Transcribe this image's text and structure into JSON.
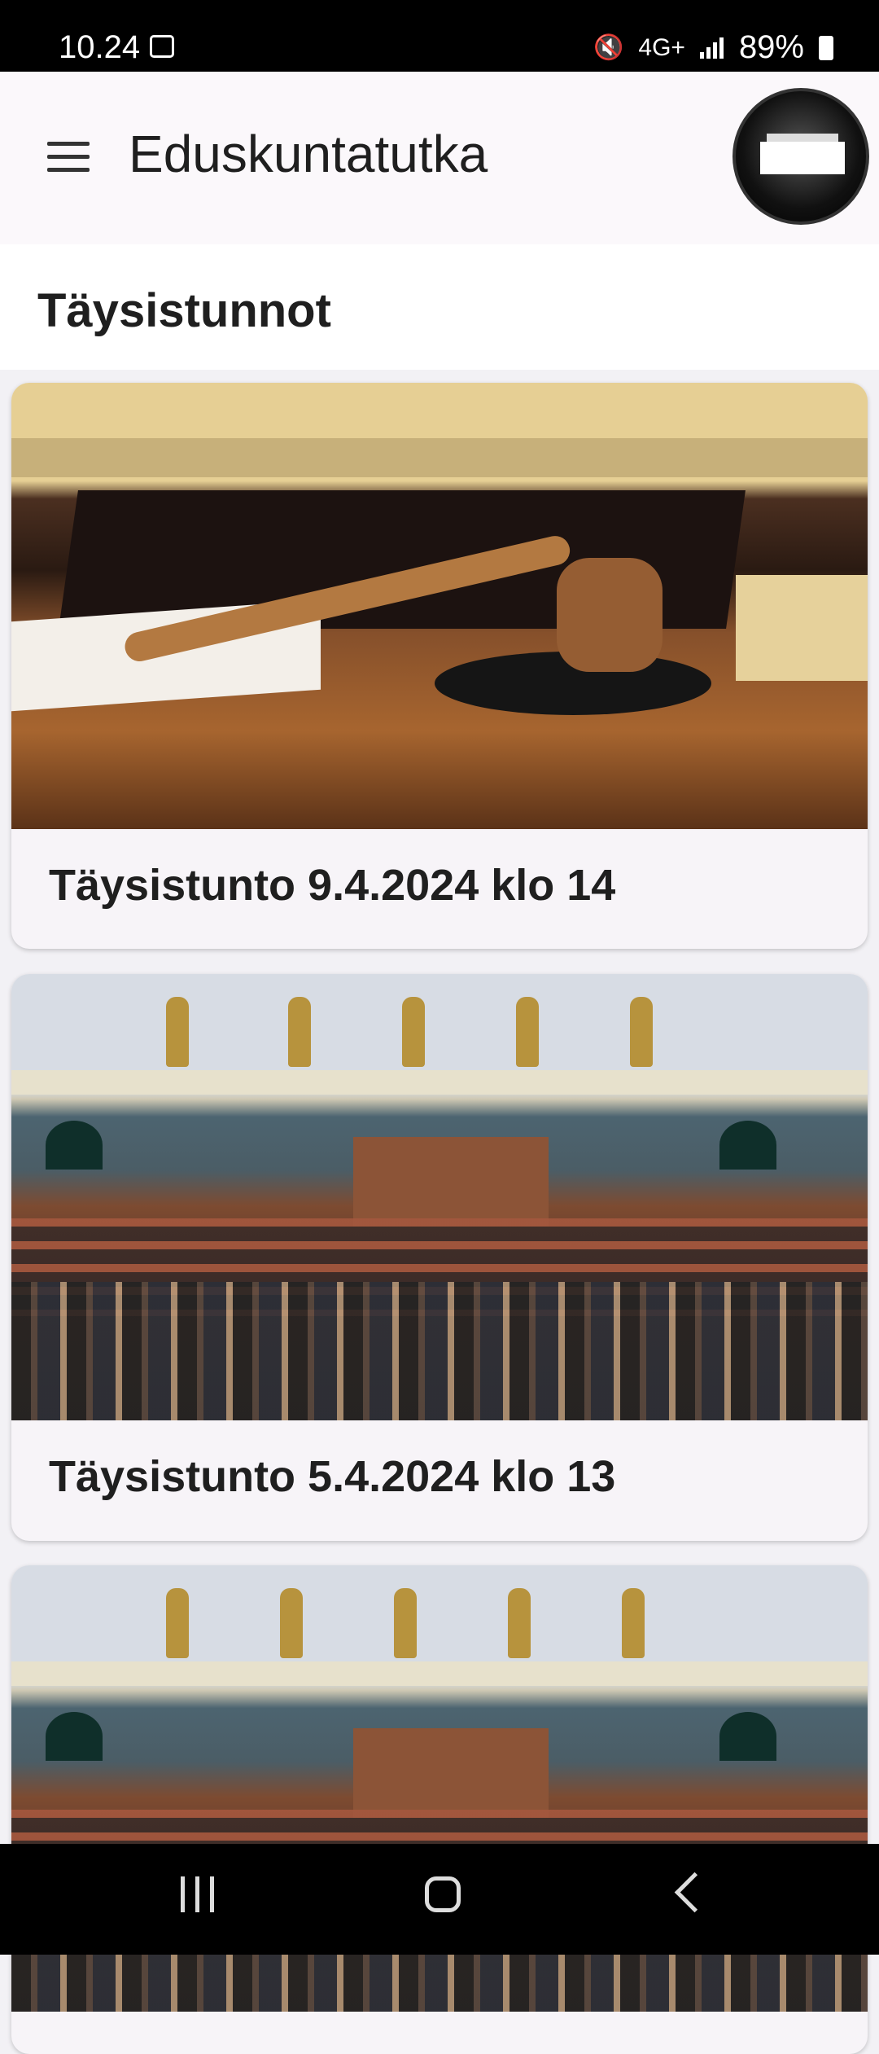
{
  "status_bar": {
    "time": "10.24",
    "battery": "89%",
    "network": "4G+"
  },
  "app_bar": {
    "title": "Eduskuntatutka"
  },
  "section": {
    "title": "Täysistunnot"
  },
  "sessions": [
    {
      "title": "Täysistunto 9.4.2024 klo 14",
      "image": "gavel-photo"
    },
    {
      "title": "Täysistunto 5.4.2024 klo 13",
      "image": "chamber-photo"
    },
    {
      "title": "",
      "image": "chamber-photo"
    }
  ],
  "icons": {
    "menu": "menu-icon",
    "logo": "parliament-logo",
    "back": "back-icon",
    "home": "home-icon",
    "recent": "recent-apps-icon"
  }
}
